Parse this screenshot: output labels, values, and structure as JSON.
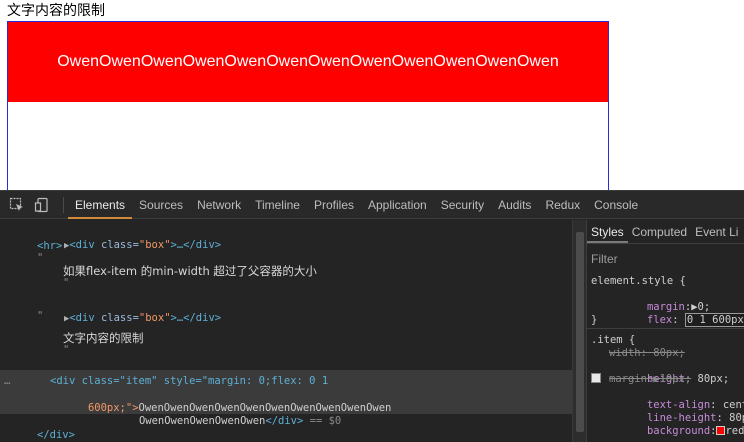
{
  "page": {
    "heading": "文字内容的限制",
    "item_text": "OwenOwenOwenOwenOwenOwenOwenOwenOwenOwenOwenOwen"
  },
  "devtools": {
    "tabs": [
      "Elements",
      "Sources",
      "Network",
      "Timeline",
      "Profiles",
      "Application",
      "Security",
      "Audits",
      "Redux",
      "Console"
    ],
    "active_tab": "Elements",
    "dom": {
      "line1_open": "<div ",
      "line1_attr": "class=",
      "line1_val": "\"box\"",
      "line1_rest": ">…</div>",
      "hr": "<hr>",
      "quote": "\"",
      "comment1": "如果flex-item 的min-width 超过了父容器的大小",
      "comment2": "文字内容的限制",
      "selected_line1": "<div class=\"item\" style=\"margin: 0;flex: 0 1",
      "selected_line2_a": "600px;\">",
      "selected_line2_b": "OwenOwenOwenOwenOwenOwenOwenOwenOwenOwen",
      "selected_line3_a": "OwenOwenOwenOwenOwen",
      "selected_line3_b": "</div>",
      "selected_line3_c": " == $0",
      "close_div": "</div>"
    },
    "styles": {
      "tabs": [
        "Styles",
        "Computed",
        "Event Li"
      ],
      "filter_placeholder": "Filter",
      "element_style_selector": "element.style {",
      "margin_prop": "margin",
      "margin_val": "▶0;",
      "flex_prop": "flex",
      "flex_val": "0 1 600px;",
      "close_brace": "}",
      "item_selector": ".item {",
      "width_line": "width: 80px;",
      "height_prop": "height",
      "height_val": "80px;",
      "margin2_line": "margin:▶10px;",
      "text_align_prop": "text-align",
      "text_align_val": "center;",
      "line_height_prop": "line-height",
      "line_height_val": "80px;",
      "background_prop": "background",
      "background_val": "red;",
      "background_color": "#ff0000"
    }
  }
}
